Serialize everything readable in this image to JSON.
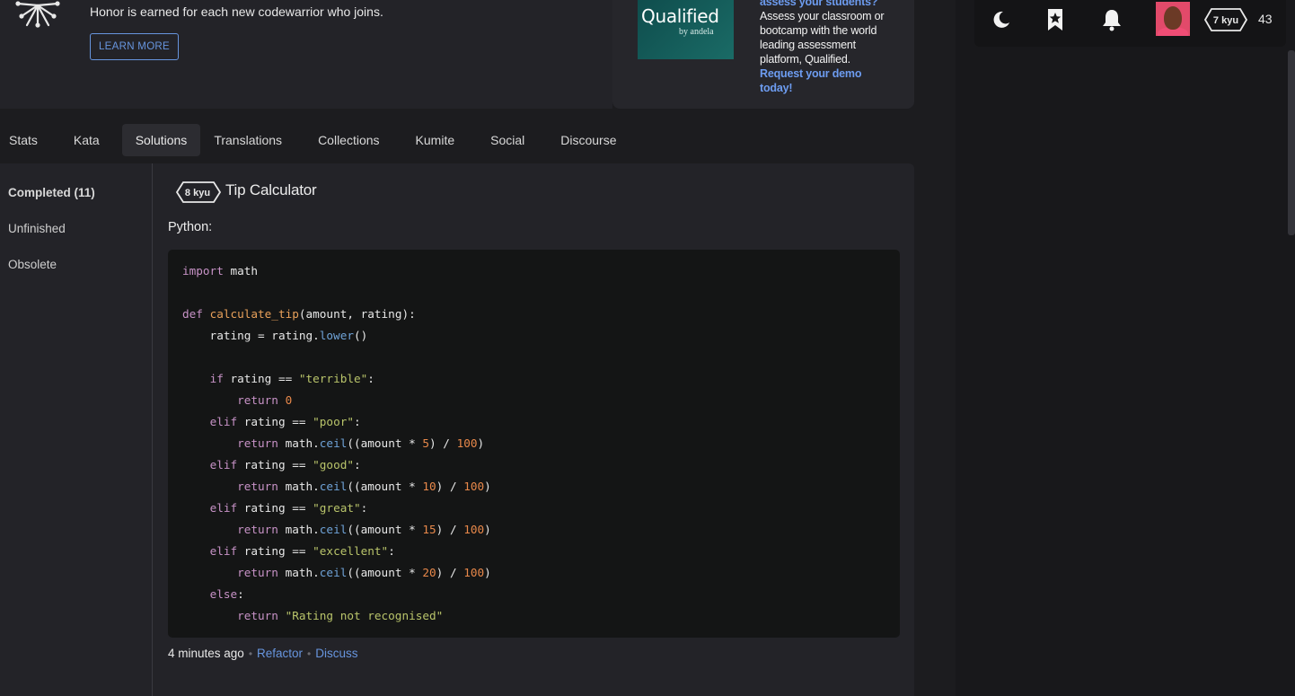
{
  "banner": {
    "honor_text": "Honor is earned for each new codewarrior who joins.",
    "learn_more": "LEARN MORE"
  },
  "ad": {
    "logo_main": "Qualified",
    "logo_sub": "by andela",
    "headline_partial": "assess your students?",
    "body": "Assess your classroom or bootcamp with the world leading assessment platform, Qualified.",
    "cta": "Request your demo today!"
  },
  "user_bar": {
    "icons": [
      "moon-icon",
      "bookmark-star-icon",
      "bell-icon"
    ],
    "rank": "7 kyu",
    "honor": "43"
  },
  "tabs": [
    {
      "label": "Stats",
      "active": false
    },
    {
      "label": "Kata",
      "active": false
    },
    {
      "label": "Solutions",
      "active": true
    },
    {
      "label": "Translations",
      "active": false
    },
    {
      "label": "Collections",
      "active": false
    },
    {
      "label": "Kumite",
      "active": false
    },
    {
      "label": "Social",
      "active": false
    },
    {
      "label": "Discourse",
      "active": false
    }
  ],
  "side_nav": {
    "completed": "Completed (11)",
    "unfinished": "Unfinished",
    "obsolete": "Obsolete"
  },
  "solution": {
    "kyu": "8 kyu",
    "title": "Tip Calculator",
    "language": "Python:",
    "code_lines": [
      "import math",
      "",
      "def calculate_tip(amount, rating):",
      "    rating = rating.lower()",
      "",
      "    if rating == \"terrible\":",
      "        return 0",
      "    elif rating == \"poor\":",
      "        return math.ceil((amount * 5) / 100)",
      "    elif rating == \"good\":",
      "        return math.ceil((amount * 10) / 100)",
      "    elif rating == \"great\":",
      "        return math.ceil((amount * 15) / 100)",
      "    elif rating == \"excellent\":",
      "        return math.ceil((amount * 20) / 100)",
      "    else:",
      "        return \"Rating not recognised\""
    ],
    "time": "4 minutes ago",
    "refactor": "Refactor",
    "discuss": "Discuss"
  },
  "colors": {
    "accent": "#6795de",
    "keyword": "#c792c6",
    "function": "#e8a05a",
    "string": "#b9c46a",
    "number": "#e8884a",
    "method": "#6fa3d8"
  }
}
